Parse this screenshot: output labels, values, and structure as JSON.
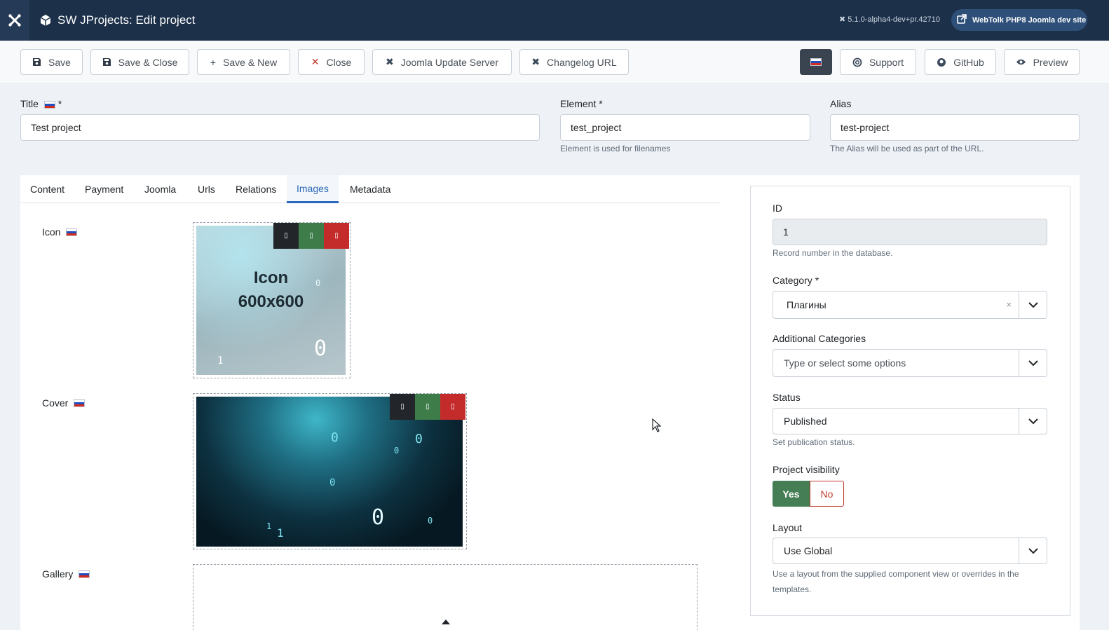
{
  "header": {
    "title": "SW JProjects: Edit project",
    "version": "5.1.0-alpha4-dev+pr.42710",
    "site_link": "WebTolk PHP8 Joomla dev site"
  },
  "toolbar": {
    "save": "Save",
    "save_close": "Save & Close",
    "save_new": "Save & New",
    "close": "Close",
    "update_server": "Joomla Update Server",
    "changelog": "Changelog URL",
    "support": "Support",
    "github": "GitHub",
    "preview": "Preview"
  },
  "fields": {
    "title_label": "Title",
    "required_mark": "*",
    "title_value": "Test project",
    "element_label": "Element *",
    "element_value": "test_project",
    "element_hint": "Element is used for filenames",
    "alias_label": "Alias",
    "alias_value": "test-project",
    "alias_hint": "The Alias will be used as part of the URL."
  },
  "tabs": [
    {
      "label": "Content"
    },
    {
      "label": "Payment"
    },
    {
      "label": "Joomla"
    },
    {
      "label": "Urls"
    },
    {
      "label": "Relations"
    },
    {
      "label": "Images",
      "active": true
    },
    {
      "label": "Metadata"
    }
  ],
  "images": {
    "icon_label": "Icon",
    "icon_text_1": "Icon",
    "icon_text_2": "600x600",
    "cover_label": "Cover",
    "gallery_label": "Gallery"
  },
  "panel": {
    "id_label": "ID",
    "id_value": "1",
    "id_hint": "Record number in the database.",
    "category_label": "Category *",
    "category_value": "Плагины",
    "category_clear": "×",
    "add_categories_label": "Additional Categories",
    "add_categories_placeholder": "Type or select some options",
    "status_label": "Status",
    "status_value": "Published",
    "status_hint": "Set publication status.",
    "visibility_label": "Project visibility",
    "visibility_yes": "Yes",
    "visibility_no": "No",
    "layout_label": "Layout",
    "layout_value": "Use Global",
    "layout_hint": "Use a layout from the supplied component view or overrides in the templates."
  },
  "colors": {
    "header_bg": "#1c3049",
    "accent": "#2a69b8",
    "yes_green": "#457d54",
    "no_red": "#c0392b"
  }
}
